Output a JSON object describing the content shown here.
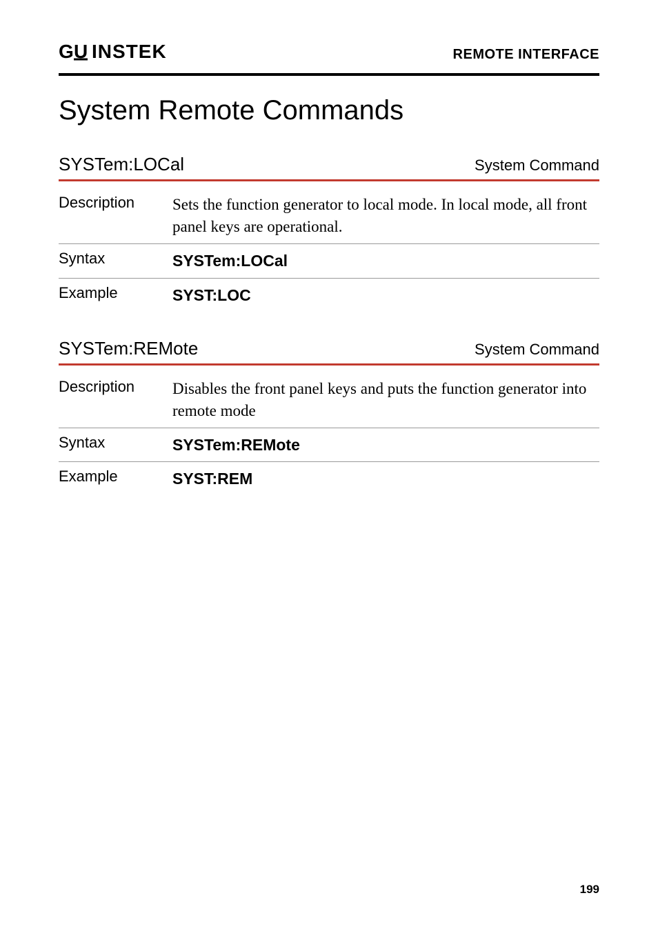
{
  "header": {
    "logo": "GᵂINSTEK",
    "section": "REMOTE INTERFACE"
  },
  "title": "System Remote Commands",
  "commands": [
    {
      "name": "SYSTem:LOCal",
      "type": "System Command",
      "rows": [
        {
          "label": "Description",
          "value": "Sets the function generator to local mode. In local mode, all front panel keys are operational.",
          "style": "serif"
        },
        {
          "label": "Syntax",
          "value": "SYSTem:LOCal",
          "style": "sans"
        },
        {
          "label": "Example",
          "value": "SYST:LOC",
          "style": "sans"
        }
      ]
    },
    {
      "name": "SYSTem:REMote",
      "type": "System Command",
      "rows": [
        {
          "label": "Description",
          "value": "Disables the front panel keys and puts the function generator into remote mode",
          "style": "serif"
        },
        {
          "label": "Syntax",
          "value": "SYSTem:REMote",
          "style": "sans"
        },
        {
          "label": "Example",
          "value": "SYST:REM",
          "style": "sans"
        }
      ]
    }
  ],
  "page_number": "199"
}
